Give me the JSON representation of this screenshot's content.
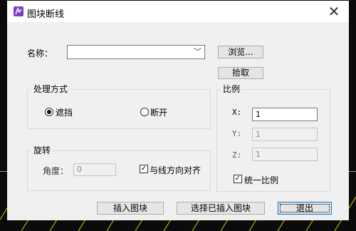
{
  "dialog": {
    "title": "图块断线",
    "close_glyph": "✕",
    "name_label": "名称：",
    "name_value": "",
    "browse_label": "浏览...",
    "pick_label": "拾取",
    "mode_group": "处理方式",
    "mode_option_mask": "遮挡",
    "mode_option_break": "断开",
    "mode_selected": "遮挡",
    "rotation_group": "旋转",
    "angle_label": "角度：",
    "angle_value": "0",
    "align_with_line_label": "与线方向对齐",
    "align_with_line_checked": true,
    "scale_group": "比例",
    "x_label": "X:",
    "x_value": "1",
    "y_label": "Y:",
    "y_value": "1",
    "z_label": "Z:",
    "z_value": "1",
    "uniform_scale_label": "统一比例",
    "uniform_scale_checked": true,
    "insert_block_label": "插入图块",
    "select_inserted_label": "选择已插入图块",
    "exit_label": "退出"
  },
  "colors": {
    "dialog_bg": "#f0f0f0",
    "titlebar_bg": "#ffffff",
    "app_icon": "#7a3cc7",
    "canvas_bg": "#0b0b0b",
    "hatch": "#c8c800"
  }
}
